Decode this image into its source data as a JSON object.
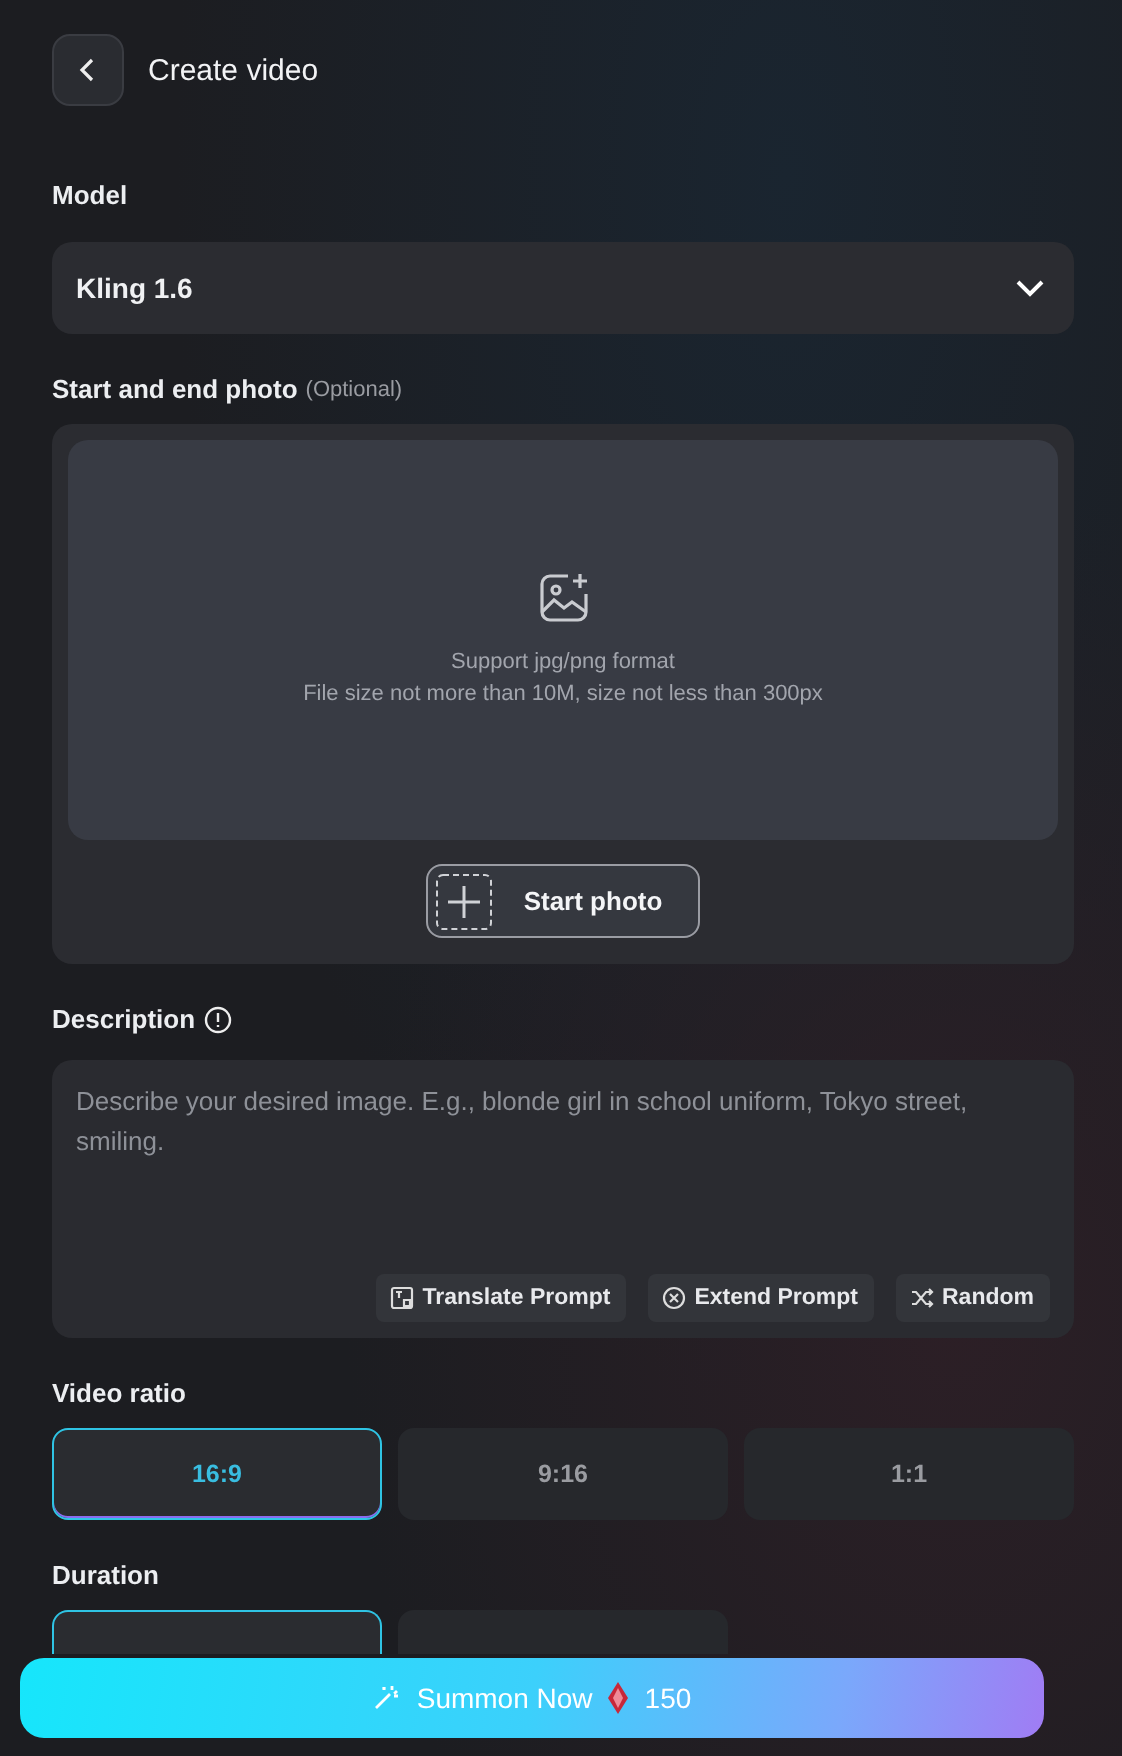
{
  "header": {
    "title": "Create video"
  },
  "model": {
    "label": "Model",
    "value": "Kling 1.6"
  },
  "photo": {
    "label": "Start and end photo",
    "note": "(Optional)",
    "hint_lines": [
      "Support jpg/png format",
      "File size not more than 10M, size not less than 300px"
    ],
    "button": "Start photo"
  },
  "description": {
    "label": "Description",
    "placeholder": "Describe your desired image. E.g., blonde girl in school uniform, Tokyo street, smiling.",
    "tools": [
      {
        "kind": "translate",
        "label": "Translate Prompt"
      },
      {
        "kind": "extend",
        "label": "Extend Prompt"
      },
      {
        "kind": "random",
        "label": "Random"
      }
    ]
  },
  "video_ratio": {
    "label": "Video ratio",
    "options": [
      {
        "label": "16:9",
        "selected": true
      },
      {
        "label": "9:16",
        "selected": false
      },
      {
        "label": "1:1",
        "selected": false
      }
    ]
  },
  "duration": {
    "label": "Duration",
    "options": [
      {
        "selected": true
      },
      {
        "selected": false
      }
    ]
  },
  "summon": {
    "label": "Summon Now",
    "cost": "150"
  }
}
